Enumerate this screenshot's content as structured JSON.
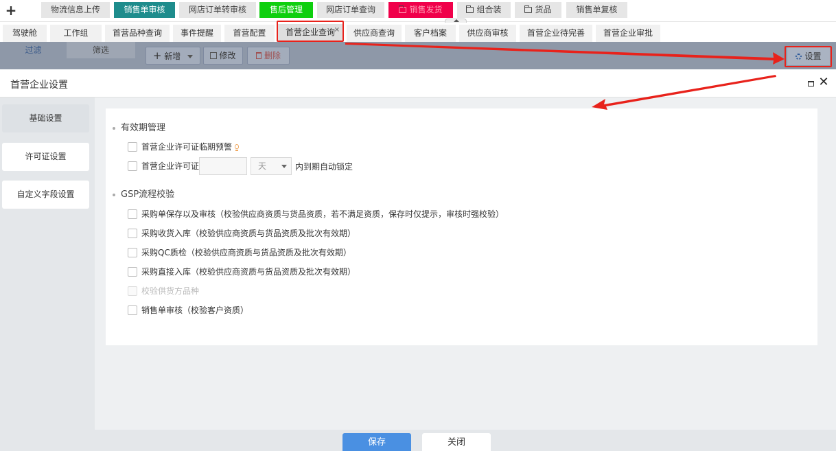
{
  "colors": {
    "mod_active": "#1e8c8c",
    "mod_green": "#0fcf0f",
    "mod_red": "#f0004a",
    "annotation_red": "#e8221b",
    "primary_blue": "#4a90e2"
  },
  "topbar": {
    "add_icon": "+",
    "modules": [
      {
        "label": "物流信息上传",
        "icon": "",
        "style": "default"
      },
      {
        "label": "销售单审核",
        "icon": "",
        "style": "active"
      },
      {
        "label": "网店订单转审核",
        "icon": "",
        "style": "default"
      },
      {
        "label": "售后管理",
        "icon": "",
        "style": "green"
      },
      {
        "label": "网店订单查询",
        "icon": "",
        "style": "default"
      },
      {
        "label": "销售发货",
        "icon": "folder-icon",
        "style": "red"
      },
      {
        "label": "组合装",
        "icon": "folder-icon",
        "style": "default"
      },
      {
        "label": "货品",
        "icon": "folder-icon",
        "style": "default"
      },
      {
        "label": "销售单复核",
        "icon": "",
        "style": "default"
      }
    ]
  },
  "tabs": [
    {
      "label": "驾驶舱"
    },
    {
      "label": "工作组"
    },
    {
      "label": "首营品种查询"
    },
    {
      "label": "事件提醒"
    },
    {
      "label": "首营配置"
    },
    {
      "label": "首营企业查询",
      "active": true,
      "close": "×"
    },
    {
      "label": "供应商查询"
    },
    {
      "label": "客户档案"
    },
    {
      "label": "供应商审核"
    },
    {
      "label": "首营企业待完善"
    },
    {
      "label": "首营企业审批"
    }
  ],
  "toolbar": {
    "filter_label": "过滤",
    "screen_label": "筛选",
    "add_label": "新增",
    "edit_label": "修改",
    "delete_label": "删除",
    "settings_label": "设置"
  },
  "modal": {
    "title": "首营企业设置",
    "nav": [
      {
        "label": "基础设置",
        "active": true
      },
      {
        "label": "许可证设置"
      },
      {
        "label": "自定义字段设置"
      }
    ],
    "sections": {
      "validity_title": "有效期管理",
      "gsp_title": "GSP流程校验"
    },
    "validity": {
      "warn_label": "首营企业许可证临期预警",
      "lock_prefix": "首营企业许可证",
      "days_value": "",
      "unit_value": "天",
      "lock_suffix": "内到期自动锁定"
    },
    "gsp_options": [
      {
        "label": "采购单保存以及审核（校验供应商资质与货品资质，若不满足资质，保存时仅提示，审核时强校验）",
        "checked": false,
        "disabled": false
      },
      {
        "label": "采购收货入库（校验供应商资质与货品资质及批次有效期）",
        "checked": false,
        "disabled": false
      },
      {
        "label": "采购QC质检（校验供应商资质与货品资质及批次有效期）",
        "checked": false,
        "disabled": false
      },
      {
        "label": "采购直接入库（校验供应商资质与货品资质及批次有效期）",
        "checked": false,
        "disabled": false
      },
      {
        "label": "校验供货方品种",
        "checked": false,
        "disabled": true
      },
      {
        "label": "销售单审核（校验客户资质）",
        "checked": false,
        "disabled": false
      }
    ],
    "footer": {
      "save_label": "保存",
      "cancel_label": "关闭"
    }
  }
}
